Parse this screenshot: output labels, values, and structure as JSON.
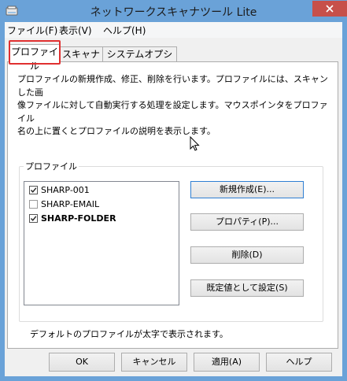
{
  "window": {
    "title": "ネットワークスキャナツール Lite",
    "close_glyph": "x"
  },
  "menu": [
    {
      "label": "ファイル(F)"
    },
    {
      "label": "表示(V)"
    },
    {
      "label": "ヘルプ(H)"
    }
  ],
  "tabs": [
    {
      "label": "プロファイル",
      "active": true
    },
    {
      "label": "スキャナ",
      "active": false
    },
    {
      "label": "システムオプション",
      "active": false
    }
  ],
  "profile_tab": {
    "description": "プロファイルの新規作成、修正、削除を行います。プロファイルには、スキャンした画\n像ファイルに対して自動実行する処理を設定します。マウスポインタをプロファイル\n名の上に置くとプロファイルの説明を表示します。",
    "group_label": "プロファイル",
    "profiles": [
      {
        "name": "SHARP-001",
        "checked": true,
        "is_default": false
      },
      {
        "name": "SHARP-EMAIL",
        "checked": false,
        "is_default": false
      },
      {
        "name": "SHARP-FOLDER",
        "checked": true,
        "is_default": true
      }
    ],
    "buttons": {
      "new": "新規作成(E)...",
      "properties": "プロパティ(P)...",
      "delete": "削除(D)",
      "set_default": "既定値として設定(S)"
    },
    "default_note": "デフォルトのプロファイルが太字で表示されます。"
  },
  "dialog_buttons": {
    "ok": "OK",
    "cancel": "キャンセル",
    "apply": "適用(A)",
    "help": "ヘルプ"
  },
  "colors": {
    "titlebar": "#6aa2d8",
    "close_button": "#c7504a",
    "tab_highlight": "#e03030"
  }
}
